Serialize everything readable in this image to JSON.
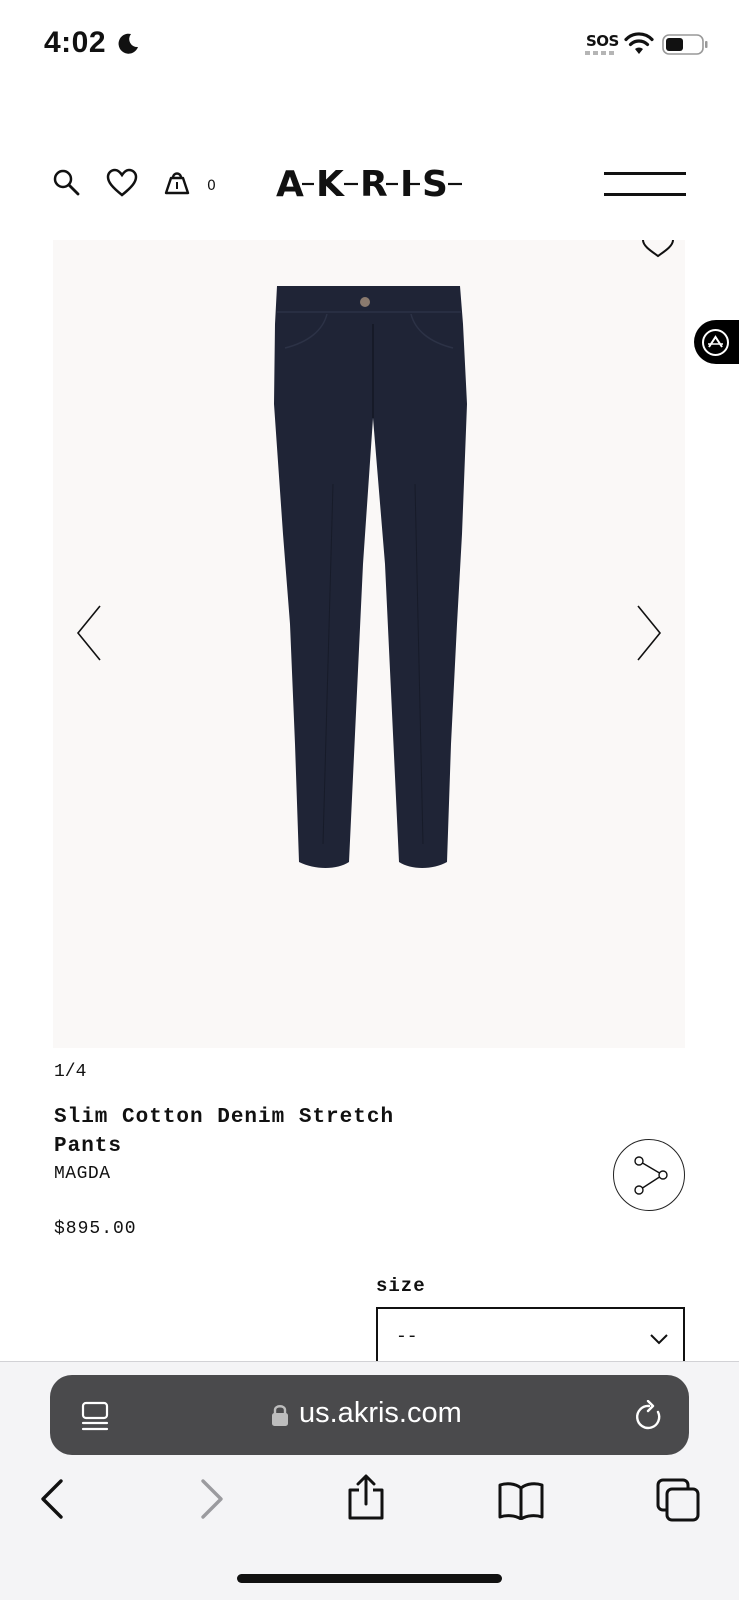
{
  "status_bar": {
    "time": "4:02",
    "sos": "SOS",
    "icons": [
      "moon-icon",
      "wifi-icon",
      "battery-icon"
    ]
  },
  "header": {
    "cart_count": "0",
    "logo": "A-K-R-I-S-",
    "icons": [
      "search-icon",
      "heart-icon",
      "bag-icon",
      "menu-icon"
    ]
  },
  "gallery": {
    "counter": "1/4",
    "icons": [
      "wishlist-icon",
      "prev-arrow-icon",
      "next-arrow-icon"
    ]
  },
  "product": {
    "title": "Slim Cotton Denim Stretch Pants",
    "line": "MAGDA",
    "price": "$895.00",
    "color": "#1f2436"
  },
  "size": {
    "label": "size",
    "selected": "--"
  },
  "browser": {
    "url": "us.akris.com",
    "icons": [
      "tabs-icon",
      "lock-icon",
      "reload-icon",
      "back-icon",
      "forward-icon",
      "share-icon",
      "bookmarks-icon",
      "tabs-overview-icon"
    ]
  }
}
